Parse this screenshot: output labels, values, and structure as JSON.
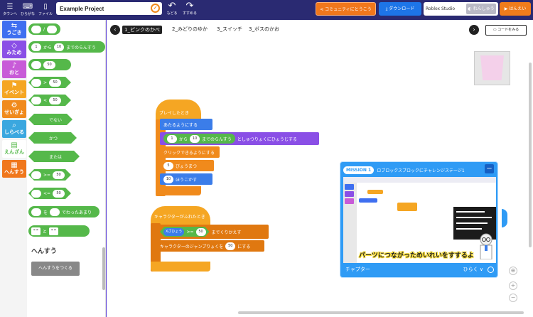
{
  "topbar": {
    "menu_label": "タウンへ",
    "hiragana_label": "ひらがな",
    "file_label": "ファイル",
    "project_title": "Example Project",
    "undo_label": "もどる",
    "redo_label": "すすめる",
    "community_label": "コミュニティにとうこう",
    "download_label": "ダウンロード",
    "roblox_label": "Roblox Studio",
    "renshu_label": "れんしゅう",
    "hannei_label": "はんえい",
    "colors": {
      "bar": "#2a2a72",
      "community": "#f0771c",
      "download": "#1d75e8"
    }
  },
  "categories": [
    {
      "icon": "motion-icon",
      "glyph": "⇆",
      "label": "うごき",
      "color": "#3f6ff0"
    },
    {
      "icon": "looks-icon",
      "glyph": "◇",
      "label": "みため",
      "color": "#8a4fe6"
    },
    {
      "icon": "sound-icon",
      "glyph": "♪",
      "label": "おと",
      "color": "#c85bd8"
    },
    {
      "icon": "event-icon",
      "glyph": "⚑",
      "label": "イベント",
      "color": "#f5a623"
    },
    {
      "icon": "control-icon",
      "glyph": "⚙",
      "label": "せいぎょ",
      "color": "#f08a1c"
    },
    {
      "icon": "sensing-icon",
      "glyph": "⌕",
      "label": "しらべる",
      "color": "#3aa7df"
    },
    {
      "icon": "operators-icon",
      "glyph": "▤",
      "label": "えんざん",
      "color": "#ffffff"
    },
    {
      "icon": "variables-icon",
      "glyph": "▦",
      "label": "へんすう",
      "color": "#f0771c"
    }
  ],
  "palette": {
    "divide": "/",
    "random_from": "1",
    "random_kara": "から",
    "random_to": "10",
    "random_suffix": "までのらんすう",
    "n50": "50",
    "gt": ">",
    "lt": "<",
    "eq": "=",
    "not": "でない",
    "and": "かつ",
    "or": "または",
    "gte": ">=",
    "lte": "<=",
    "mod_wo": "を",
    "mod_suffix": "でわったあまり",
    "join_to": "と",
    "quote": "❝ ❞",
    "var_header": "へんすう",
    "make_var": "へんすうをつくる"
  },
  "stages": {
    "tabs": [
      "1_ピンクのかべ",
      "2_みどりのゆか",
      "3_スイッチ",
      "3_ボスのかお"
    ],
    "code_view": "コードをみる"
  },
  "script1": {
    "hat": "プレイしたとき",
    "forever": "あたるようにする",
    "rand_from": "1",
    "rand_kara": "から",
    "rand_to": "10",
    "rand_suffix": "までのらんすう",
    "impulse": "としゅつりょくにひょうじする",
    "clickable": "クリックできるようにする",
    "wait_n": "5",
    "wait_label": "びょうまつ",
    "move_n": "10",
    "move_label": "ほうこかす"
  },
  "script2": {
    "hat": "キャラクターがふれたとき",
    "cond_var": "Xざひょう",
    "cond_op": ">=",
    "cond_n": "50",
    "cond_suffix": "までくりかえす",
    "jump_label": "キャラクターのジャンプりょくを",
    "jump_n": "50",
    "jump_suffix": "にする"
  },
  "mission": {
    "badge": "MISSION 1",
    "title": "ロブロックスブロックにチャレンジステージ1",
    "close": "ー",
    "subtitle": "パーツにつながっためいれいをすするよ",
    "footer_left": "チャプター",
    "footer_right": "ひらく ∨"
  },
  "tools": {
    "zoom_in": "+",
    "zoom_out": "−"
  }
}
